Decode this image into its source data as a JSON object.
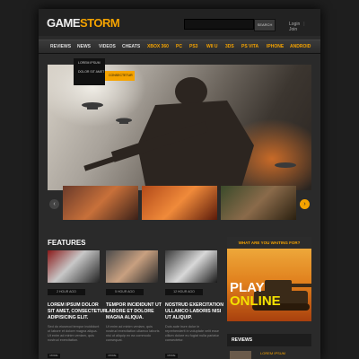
{
  "header": {
    "logo_part1": "GAME",
    "logo_part2": "STORM",
    "search_button": "SEARCH",
    "login": "Login",
    "join": "Join"
  },
  "nav": {
    "items": [
      {
        "label": "REVIEWS"
      },
      {
        "label": "NEWS"
      },
      {
        "label": "VIDEOS"
      },
      {
        "label": "CHEATS"
      },
      {
        "label": "XBOX 360"
      },
      {
        "label": "PC"
      },
      {
        "label": "PS3"
      },
      {
        "label": "WII U"
      },
      {
        "label": "3DS"
      },
      {
        "label": "PS VITA"
      },
      {
        "label": "IPHONE"
      },
      {
        "label": "ANDROID"
      }
    ],
    "dropdown": [
      "LOREM IPSUM",
      "DOLOR SIT AMET",
      "CONSECTETUR"
    ]
  },
  "features": {
    "title": "FEATURES",
    "items": [
      {
        "badge": "2 HOUR AGO",
        "title": "LOREM IPSUM DOLOR SIT AMET, CONSECTETUR ADIPISICING ELIT.",
        "body": "Sed do eiusmod tempor incididunt ut labore et dolore magna aliqua. Ut enim ad minim veniam, quis nostrud exercitation.",
        "more": "MORE"
      },
      {
        "badge": "5 HOUR AGO",
        "title": "TEMPOR INCIDIDUNT UT LABORE ET DOLORE MAGNA ALIQUA.",
        "body": "Ut enim ad minim veniam, quis nostrud exercitation ullamco laboris nisi ut aliquip ex ea commodo consequat.",
        "more": "MORE"
      },
      {
        "badge": "12 HOUR AGO",
        "title": "NOSTRUD EXERCITATION ULLAMCO LABORIS NISI UT ALIQUIP.",
        "body": "Duis aute irure dolor in reprehenderit in voluptate velit esse cillum dolore eu fugiat nulla pariatur consectetur.",
        "more": "MORE"
      }
    ]
  },
  "ad": {
    "tagline": "WHAT ARE YOU WAITING FOR?",
    "play": "PLAY",
    "online": "ONLINE"
  },
  "reviews": {
    "title": "REVIEWS",
    "first": "LOREM IPSUM"
  },
  "colors": {
    "accent": "#f5a300",
    "background": "#2a2a2a"
  }
}
